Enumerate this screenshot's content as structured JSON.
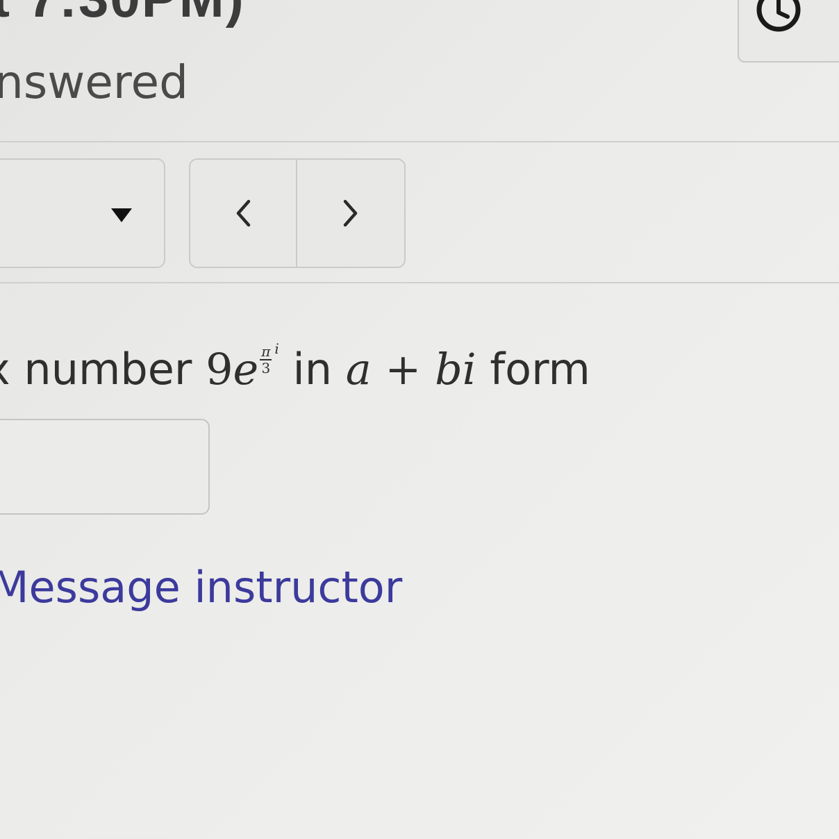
{
  "header": {
    "title_fragment": "t 7:30PM)",
    "status_fragment": "nswered"
  },
  "question": {
    "text_prefix": "x number ",
    "math_coefficient": "9",
    "math_base": "e",
    "exponent_numerator": "π",
    "exponent_denominator": "3",
    "exponent_i": "i",
    "text_middle": " in ",
    "form_a": "a",
    "form_plus": " + ",
    "form_bi": "bi",
    "text_suffix": " form"
  },
  "answer": {
    "value": "",
    "placeholder": ""
  },
  "links": {
    "message_instructor": "Message instructor"
  },
  "icons": {
    "clock": "clock-icon",
    "dropdown": "caret-down-icon",
    "previous": "chevron-left-icon",
    "next": "chevron-right-icon"
  },
  "colors": {
    "link": "#3c3a9c",
    "background": "#ececea",
    "border": "#cacac8"
  }
}
